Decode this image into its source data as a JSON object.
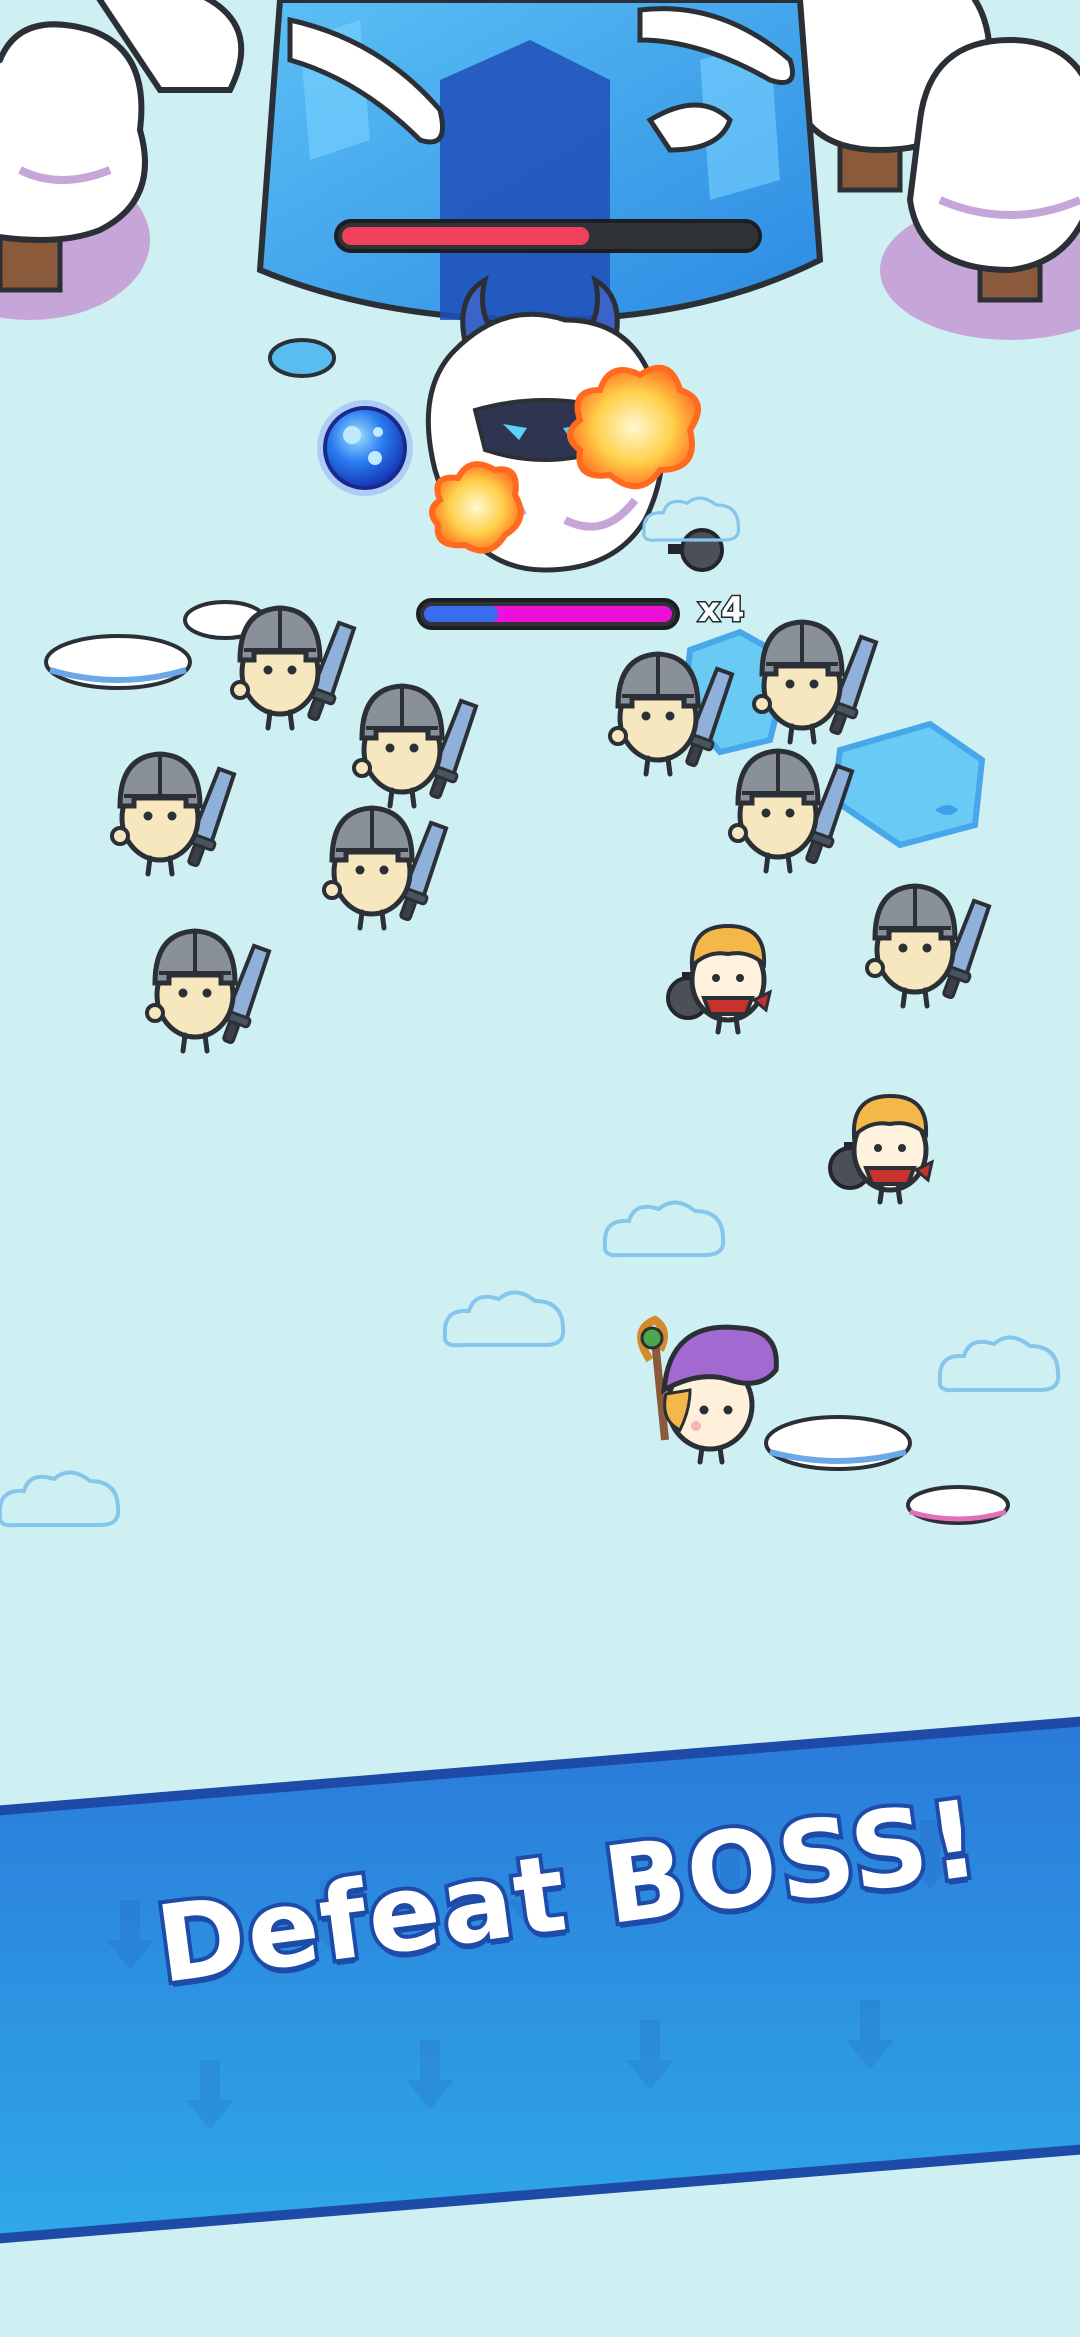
{
  "game": {
    "boss_health": 0.6,
    "player_charge": 0.3,
    "combo_multiplier": "x4",
    "headline": "Defeat BOSS!"
  },
  "colors": {
    "background": "#cff0f2",
    "boss_bar_fill": "#f0405c",
    "charge_blue": "#3a6cf0",
    "charge_magenta": "#ee0fd8",
    "banner_blue": "#2a86e0",
    "ice": "#3aa0ea"
  },
  "icons": {
    "boss": "yeti-boss-icon",
    "orb": "magic-orb-icon",
    "explosion": "fire-explosion-icon",
    "bomb": "bomb-icon",
    "knight": "helmet-knight-icon",
    "bomber": "bandana-bomber-icon",
    "wizard": "wizard-hero-icon"
  }
}
